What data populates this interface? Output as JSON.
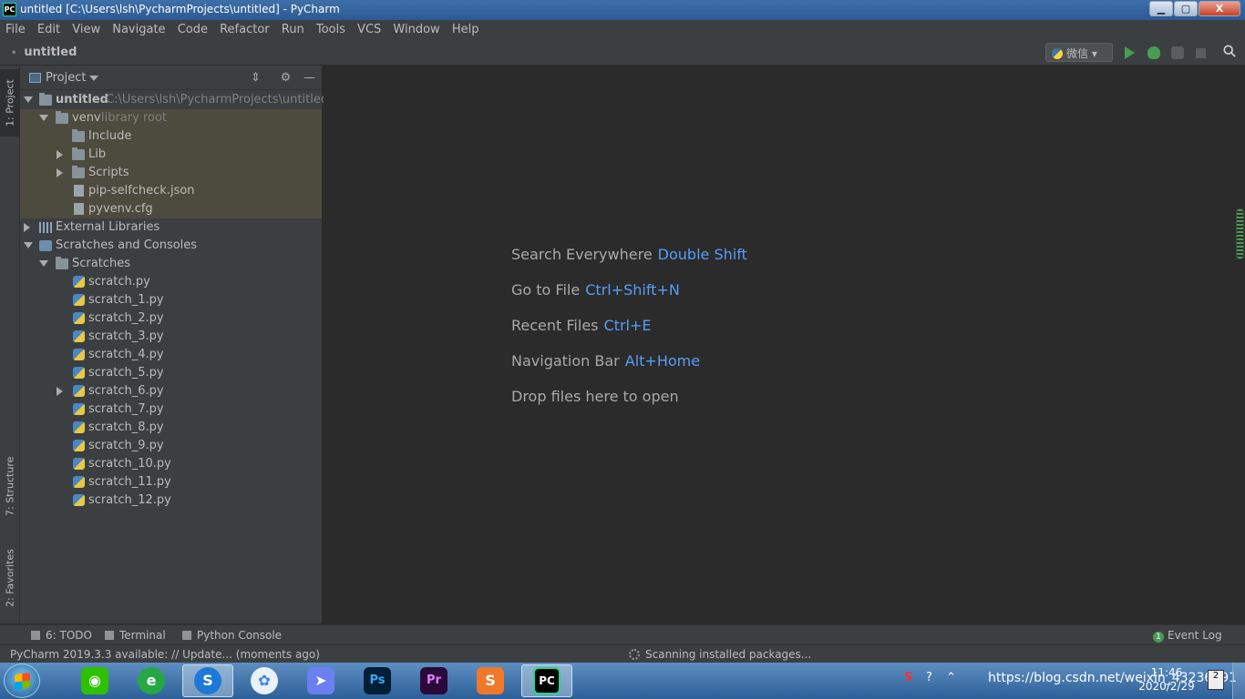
{
  "window": {
    "app_icon": "PC",
    "title": "untitled [C:\\Users\\lsh\\PycharmProjects\\untitled] - PyCharm",
    "buttons": {
      "minimize": "▁",
      "maximize": "▢",
      "close": "X"
    }
  },
  "menu": [
    "File",
    "Edit",
    "View",
    "Navigate",
    "Code",
    "Refactor",
    "Run",
    "Tools",
    "VCS",
    "Window",
    "Help"
  ],
  "navbar": {
    "project": "untitled",
    "run_config": "微信"
  },
  "side_tabs": {
    "project": "1: Project",
    "structure": "7: Structure",
    "favorites": "2: Favorites"
  },
  "project_panel": {
    "title": "Project",
    "tree": [
      {
        "label": "untitled",
        "sub": "C:\\Users\\lsh\\PycharmProjects\\untitled",
        "bold": true
      },
      {
        "label": "venv",
        "sub": "library root"
      },
      {
        "label": "Include"
      },
      {
        "label": "Lib"
      },
      {
        "label": "Scripts"
      },
      {
        "label": "pip-selfcheck.json"
      },
      {
        "label": "pyvenv.cfg"
      },
      {
        "label": "External Libraries"
      },
      {
        "label": "Scratches and Consoles"
      },
      {
        "label": "Scratches"
      },
      {
        "label": "scratch.py"
      },
      {
        "label": "scratch_1.py"
      },
      {
        "label": "scratch_2.py"
      },
      {
        "label": "scratch_3.py"
      },
      {
        "label": "scratch_4.py"
      },
      {
        "label": "scratch_5.py"
      },
      {
        "label": "scratch_6.py"
      },
      {
        "label": "scratch_7.py"
      },
      {
        "label": "scratch_8.py"
      },
      {
        "label": "scratch_9.py"
      },
      {
        "label": "scratch_10.py"
      },
      {
        "label": "scratch_11.py"
      },
      {
        "label": "scratch_12.py"
      }
    ]
  },
  "editor_hints": [
    {
      "text": "Search Everywhere",
      "key": "Double Shift"
    },
    {
      "text": "Go to File",
      "key": "Ctrl+Shift+N"
    },
    {
      "text": "Recent Files",
      "key": "Ctrl+E"
    },
    {
      "text": "Navigation Bar",
      "key": "Alt+Home"
    },
    {
      "text": "Drop files here to open",
      "key": ""
    }
  ],
  "bottom_tabs": {
    "todo": "6: TODO",
    "terminal": "Terminal",
    "python_console": "Python Console",
    "event_log": "Event Log",
    "event_count": "1"
  },
  "status": {
    "message": "PyCharm 2019.3.3 available: // Update... (moments ago)",
    "progress": "Scanning installed packages..."
  },
  "taskbar": {
    "tray_text": "https://blog.csdn.net/weixin_43236791",
    "time": "11:46",
    "date": "2020/2/29",
    "notification_count": "2"
  }
}
